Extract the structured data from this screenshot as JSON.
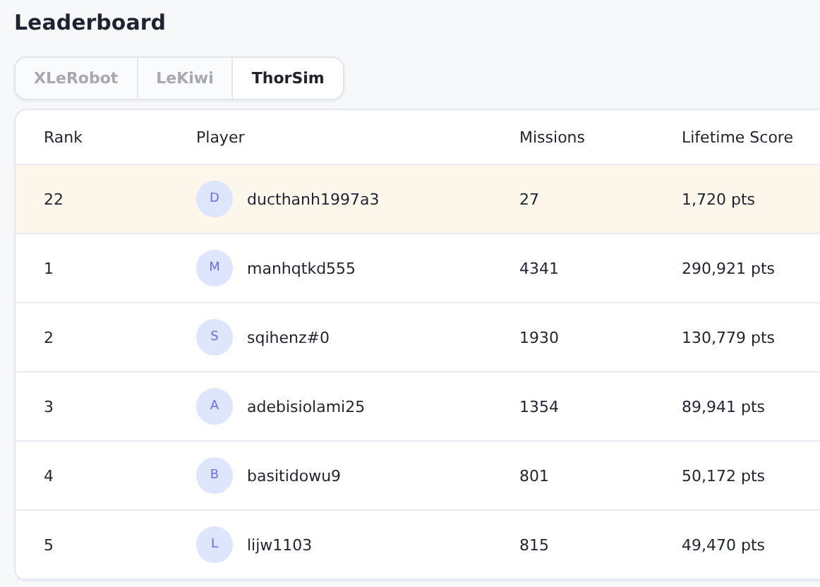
{
  "title": "Leaderboard",
  "tabs": [
    {
      "label": "XLeRobot",
      "selected": false
    },
    {
      "label": "LeKiwi",
      "selected": false
    },
    {
      "label": "ThorSim",
      "selected": true
    }
  ],
  "table": {
    "columns": [
      "Rank",
      "Player",
      "Missions",
      "Lifetime Score"
    ],
    "rows": [
      {
        "rank": "22",
        "initial": "D",
        "player": "ducthanh1997a3",
        "missions": "27",
        "score": "1,720 pts",
        "current_user": true
      },
      {
        "rank": "1",
        "initial": "M",
        "player": "manhqtkd555",
        "missions": "4341",
        "score": "290,921 pts",
        "current_user": false
      },
      {
        "rank": "2",
        "initial": "S",
        "player": "sqihenz#0",
        "missions": "1930",
        "score": "130,779 pts",
        "current_user": false
      },
      {
        "rank": "3",
        "initial": "A",
        "player": "adebisiolami25",
        "missions": "1354",
        "score": "89,941 pts",
        "current_user": false
      },
      {
        "rank": "4",
        "initial": "B",
        "player": "basitidowu9",
        "missions": "801",
        "score": "50,172 pts",
        "current_user": false
      },
      {
        "rank": "5",
        "initial": "L",
        "player": "lijw1103",
        "missions": "815",
        "score": "49,470 pts",
        "current_user": false
      }
    ]
  }
}
